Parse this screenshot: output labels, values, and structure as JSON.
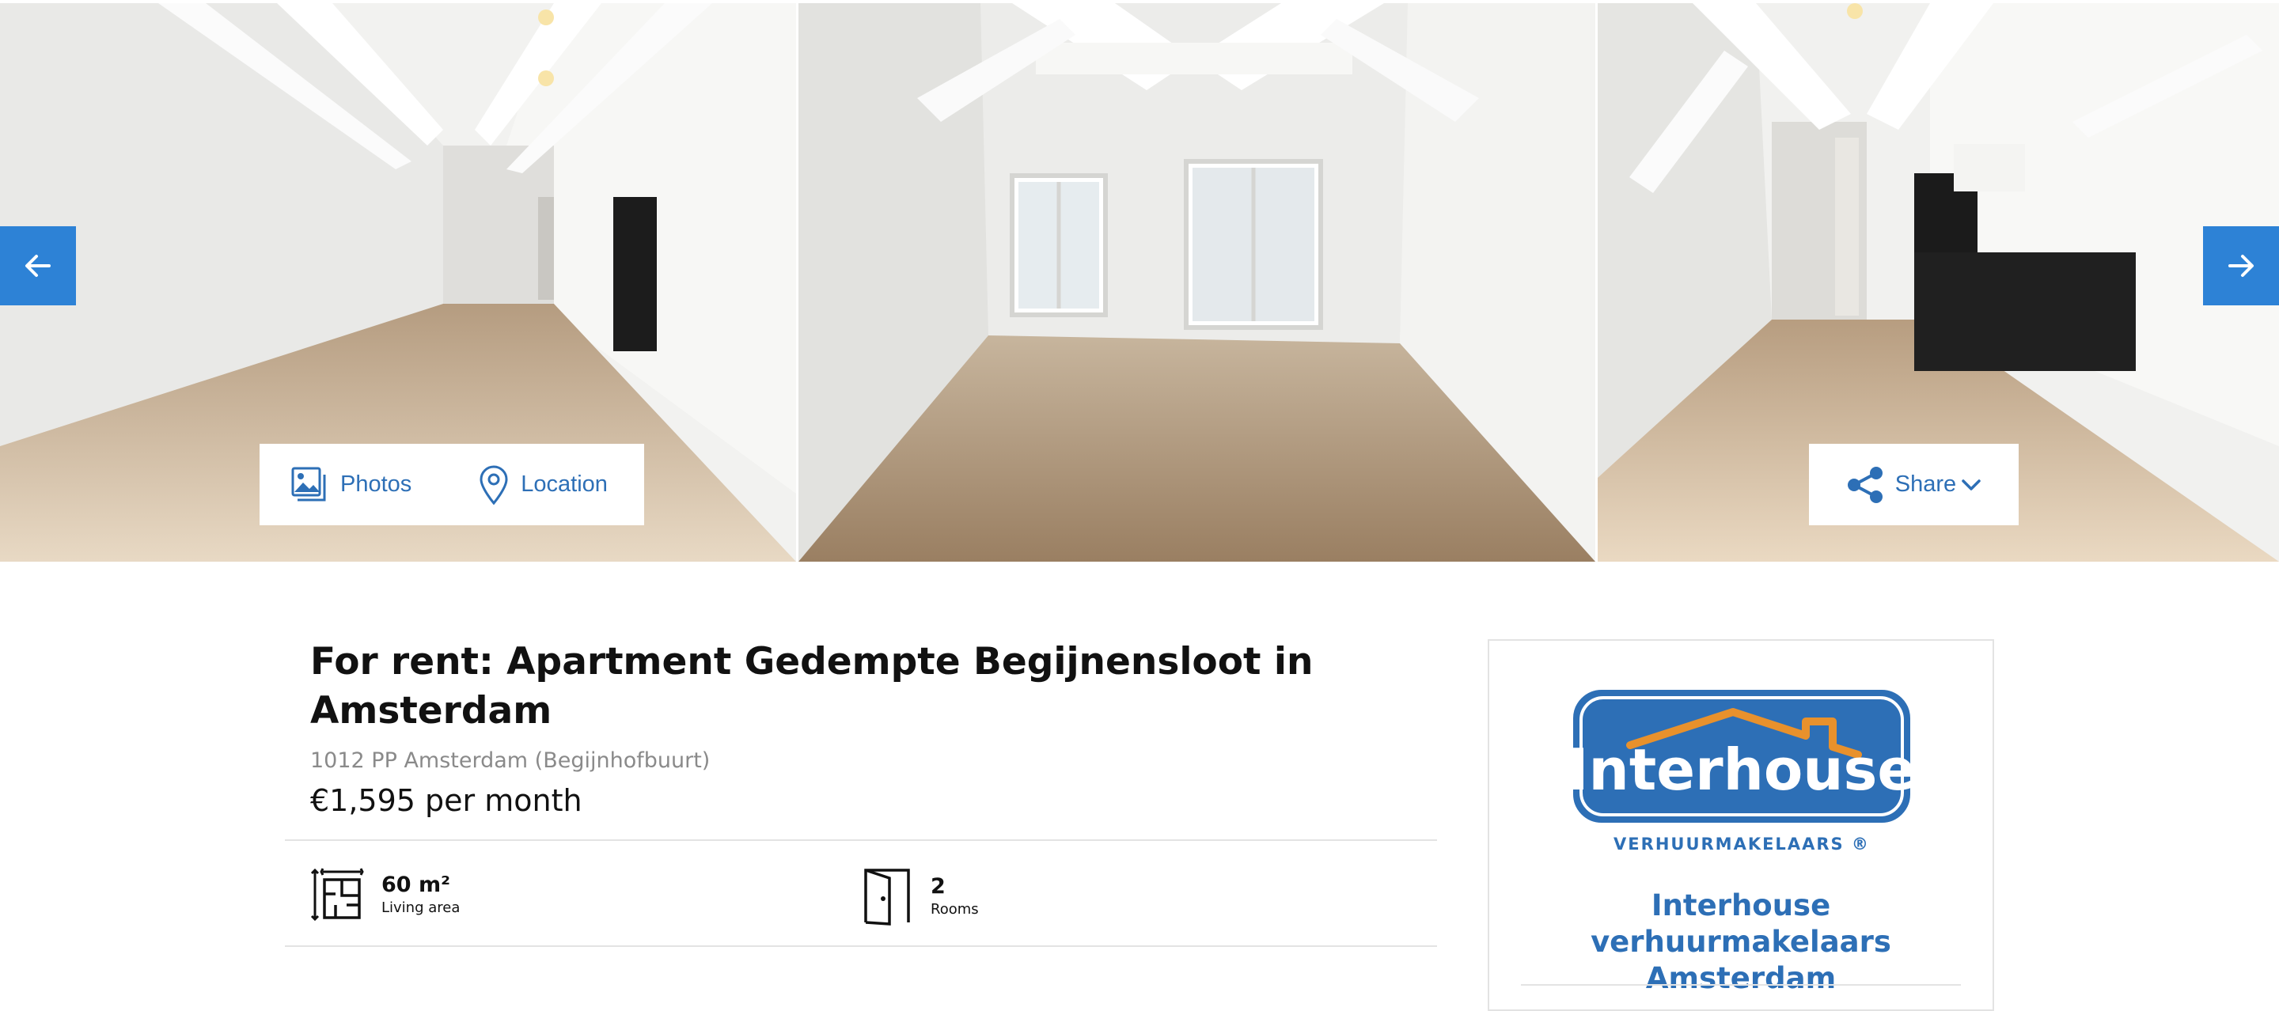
{
  "gallery": {
    "prev_label": "previous",
    "next_label": "next",
    "photos_label": "Photos",
    "location_label": "Location",
    "share_label": "Share",
    "accent_color": "#2d82d6"
  },
  "listing": {
    "title": "For rent: Apartment Gedempte Begijnensloot in Amsterdam",
    "address": "1012 PP Amsterdam (Begijnhofbuurt)",
    "price": "€1,595 per month",
    "features": [
      {
        "value": "60 m²",
        "label": "Living area",
        "icon": "floor-plan-icon"
      },
      {
        "value": "2",
        "label": "Rooms",
        "icon": "door-icon"
      }
    ]
  },
  "agent": {
    "logo_text": "Interhouse",
    "logo_tagline": "VERHUURMAKELAARS ®",
    "name": "Interhouse verhuurmakelaars Amsterdam",
    "brand_color": "#2d6fb6",
    "roof_color": "#e8912c"
  }
}
